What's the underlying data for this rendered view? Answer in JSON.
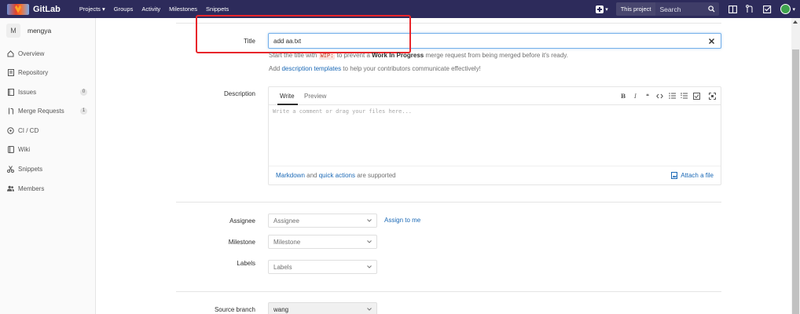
{
  "navbar": {
    "brand": "GitLab",
    "links": [
      "Projects",
      "Groups",
      "Activity",
      "Milestones",
      "Snippets"
    ],
    "projects_caret": "▾",
    "scope": "This project",
    "search_placeholder": "Search"
  },
  "sidebar": {
    "project_initial": "M",
    "project_name": "mengya",
    "items": [
      {
        "label": "Overview",
        "icon": "home-icon"
      },
      {
        "label": "Repository",
        "icon": "file-icon"
      },
      {
        "label": "Issues",
        "icon": "issues-icon",
        "badge": "0"
      },
      {
        "label": "Merge Requests",
        "icon": "merge-request-icon",
        "badge": "1"
      },
      {
        "label": "CI / CD",
        "icon": "rocket-icon"
      },
      {
        "label": "Wiki",
        "icon": "book-icon"
      },
      {
        "label": "Snippets",
        "icon": "scissors-icon"
      },
      {
        "label": "Members",
        "icon": "users-icon"
      }
    ]
  },
  "form": {
    "title_label": "Title",
    "title_value": "add aa.txt",
    "wip_hint": {
      "pre": "Start the title with",
      "code": "WIP:",
      "mid": "to prevent a",
      "bold": "Work In Progress",
      "post": "merge request from being merged before it's ready."
    },
    "template_hint": {
      "pre": "Add",
      "link": "description templates",
      "post": "to help your contributors communicate effectively!"
    },
    "description_label": "Description",
    "tabs": [
      "Write",
      "Preview"
    ],
    "toolbar_labels": {
      "bold": "B",
      "italic": "I",
      "quote": "❝"
    },
    "comment_placeholder": "Write a comment or drag your files here...",
    "footer": {
      "markdown": "Markdown",
      "and": "and",
      "quick_actions": "quick actions",
      "supported": "are supported",
      "attach": "Attach a file"
    },
    "assignee_label": "Assignee",
    "assignee_value": "Assignee",
    "assign_to_me": "Assign to me",
    "milestone_label": "Milestone",
    "milestone_value": "Milestone",
    "labels_label": "Labels",
    "labels_value": "Labels",
    "source_branch_label": "Source branch",
    "source_branch_value": "wang"
  },
  "colors": {
    "navbar": "#2d2b5b",
    "link": "#1b69b6",
    "highlight": "#e8262b"
  }
}
